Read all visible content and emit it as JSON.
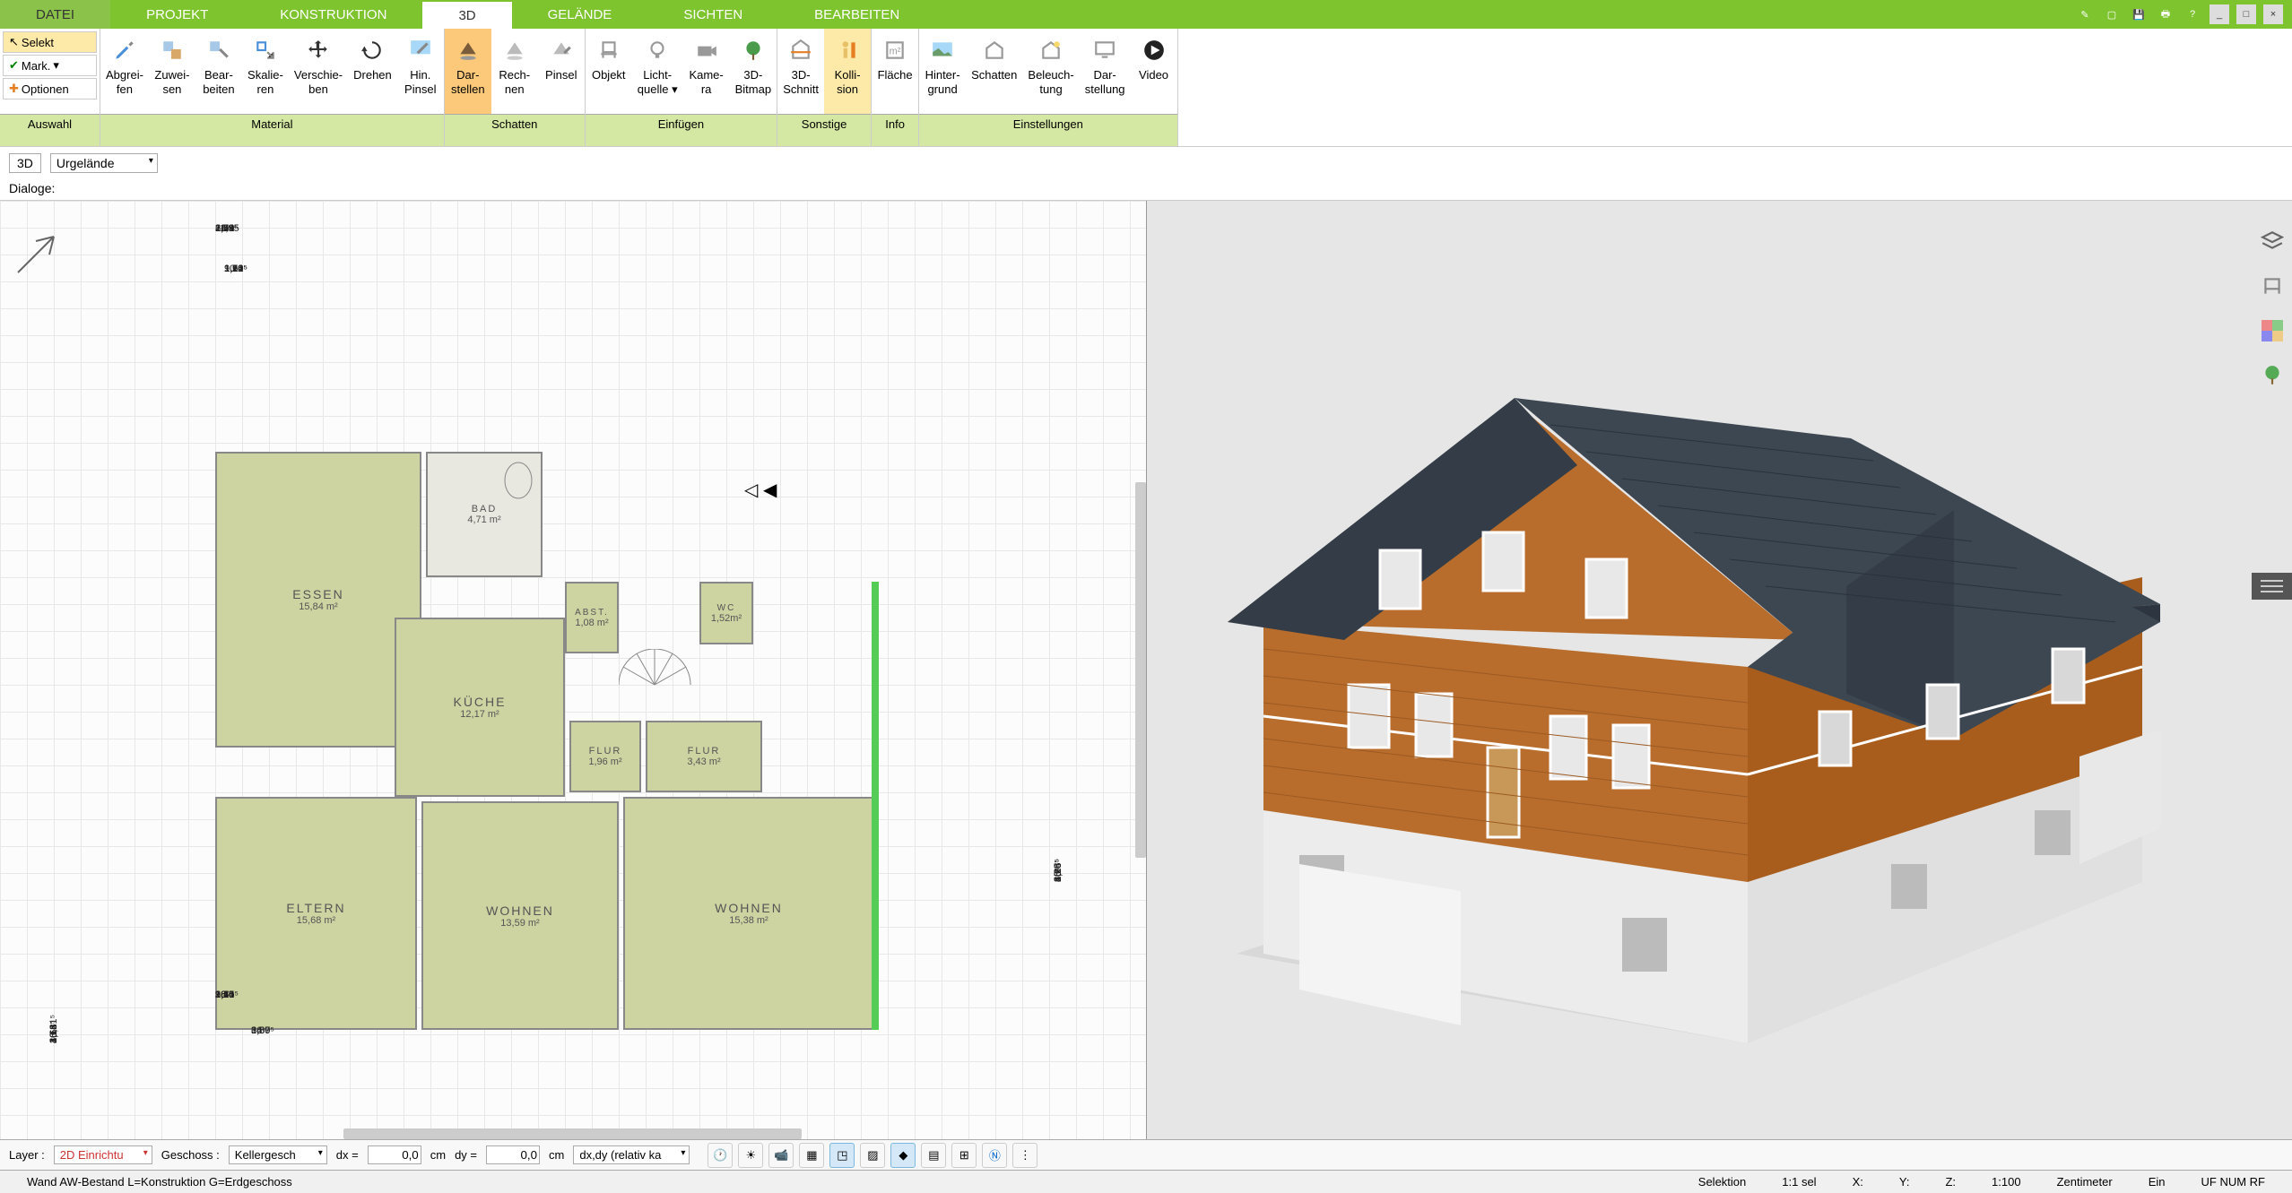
{
  "menu": {
    "items": [
      "DATEI",
      "PROJEKT",
      "KONSTRUKTION",
      "3D",
      "GELÄNDE",
      "SICHTEN",
      "BEARBEITEN"
    ],
    "active_index": 3
  },
  "ribbon": {
    "left": {
      "selekt": "Selekt",
      "mark": "Mark.",
      "optionen": "Optionen"
    },
    "groups": [
      {
        "label": "Auswahl"
      },
      {
        "label": "Material",
        "items": [
          {
            "l1": "Abgrei-",
            "l2": "fen"
          },
          {
            "l1": "Zuwei-",
            "l2": "sen"
          },
          {
            "l1": "Bear-",
            "l2": "beiten"
          },
          {
            "l1": "Skalie-",
            "l2": "ren"
          },
          {
            "l1": "Verschie-",
            "l2": "ben"
          },
          {
            "l1": "Drehen",
            "l2": ""
          },
          {
            "l1": "Hin.",
            "l2": "Pinsel"
          }
        ]
      },
      {
        "label": "Schatten",
        "items": [
          {
            "l1": "Dar-",
            "l2": "stellen",
            "active": true
          },
          {
            "l1": "Rech-",
            "l2": "nen"
          },
          {
            "l1": "Pinsel",
            "l2": ""
          }
        ]
      },
      {
        "label": "Einfügen",
        "items": [
          {
            "l1": "Objekt",
            "l2": ""
          },
          {
            "l1": "Licht-",
            "l2": "quelle ▾"
          },
          {
            "l1": "Kame-",
            "l2": "ra"
          },
          {
            "l1": "3D-",
            "l2": "Bitmap"
          }
        ]
      },
      {
        "label": "Sonstige",
        "items": [
          {
            "l1": "3D-",
            "l2": "Schnitt"
          },
          {
            "l1": "Kolli-",
            "l2": "sion",
            "active2": true
          }
        ]
      },
      {
        "label": "Info",
        "items": [
          {
            "l1": "Fläche",
            "l2": ""
          }
        ]
      },
      {
        "label": "Einstellungen",
        "items": [
          {
            "l1": "Hinter-",
            "l2": "grund"
          },
          {
            "l1": "Schatten",
            "l2": ""
          },
          {
            "l1": "Beleuch-",
            "l2": "tung"
          },
          {
            "l1": "Dar-",
            "l2": "stellung"
          },
          {
            "l1": "Video",
            "l2": ""
          }
        ]
      }
    ]
  },
  "context": {
    "mode": "3D",
    "terrain": "Urgelände",
    "dialoge": "Dialoge:"
  },
  "rooms": {
    "essen": {
      "name": "ESSEN",
      "area": "15,84 m²"
    },
    "bad": {
      "name": "BAD",
      "area": "4,71 m²"
    },
    "kueche": {
      "name": "KÜCHE",
      "area": "12,17 m²"
    },
    "abst": {
      "name": "ABST.",
      "area": "1,08 m²"
    },
    "wc": {
      "name": "WC",
      "area": "1,52m²"
    },
    "flur1": {
      "name": "FLUR",
      "area": "1,96 m²"
    },
    "flur2": {
      "name": "FLUR",
      "area": "3,43 m²"
    },
    "eltern": {
      "name": "ELTERN",
      "area": "15,68 m²"
    },
    "wohnen1": {
      "name": "WOHNEN",
      "area": "13,59 m²"
    },
    "wohnen2": {
      "name": "WOHNEN",
      "area": "15,38 m²"
    }
  },
  "dims_top": [
    "36",
    "3,44",
    "2,52",
    "1,71⁵",
    "6,69",
    "14",
    "2,19",
    "11,95",
    "2,08"
  ],
  "dims_top2": [
    "1,51",
    "1,14",
    "1,51",
    "1,12",
    "1,26",
    "90",
    "1,60⁵",
    "1,12",
    "1,92⁵",
    "1,70"
  ],
  "dims_bot": [
    "36",
    "1,15",
    "1,14",
    "2,41",
    "1,14",
    "3,45⁵",
    "1,55",
    "98",
    "36⁵",
    "1,70"
  ],
  "dims_bot2": [
    "3,80",
    "36",
    "3,87",
    "14",
    "6,09⁵"
  ],
  "dims_left": [
    "36",
    "2,13",
    "4,68",
    "1,14",
    "3,68",
    "10,21⁵",
    "4,66⁵",
    "1,14",
    "36"
  ],
  "dims_right": [
    "2,24⁵",
    "1,23⁵",
    "36⁵",
    "60",
    "25",
    "1,05",
    "80",
    "4,18⁵"
  ],
  "bottom": {
    "layer_label": "Layer :",
    "layer_value": "2D Einrichtu",
    "geschoss_label": "Geschoss :",
    "geschoss_value": "Kellergesch",
    "dx_label": "dx =",
    "dx_value": "0,0",
    "dy_label": "dy =",
    "dy_value": "0,0",
    "unit": "cm",
    "mode": "dx,dy (relativ ka"
  },
  "status": {
    "left": "Wand AW-Bestand L=Konstruktion G=Erdgeschoss",
    "selektion": "Selektion",
    "sel_ratio": "1:1 sel",
    "x": "X:",
    "y": "Y:",
    "z": "Z:",
    "scale": "1:100",
    "unit": "Zentimeter",
    "ein": "Ein",
    "flags": "UF NUM RF"
  }
}
